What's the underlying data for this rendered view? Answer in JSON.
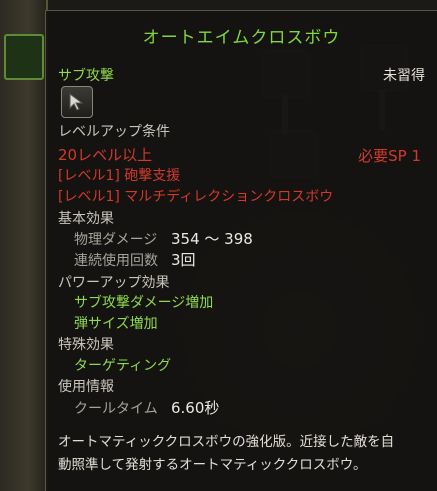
{
  "tooltip": {
    "title": "オートエイムクロスボウ",
    "subtype": "サブ攻撃",
    "learn_status": "未習得",
    "skill_icon": "crossbow-cursor-icon",
    "levelup": {
      "header": "レベルアップ条件",
      "level_req": "20レベル以上",
      "req1": "[レベル1] 砲撃支援",
      "req2": "[レベル1] マルチディレクションクロスボウ",
      "sp": "必要SP 1"
    },
    "basic": {
      "header": "基本効果",
      "damage_label": "物理ダメージ",
      "damage_value": "354 ～ 398",
      "count_label": "連続使用回数",
      "count_value": "3回"
    },
    "powerup": {
      "header": "パワーアップ効果",
      "items": [
        "サブ攻撃ダメージ増加",
        "弾サイズ増加"
      ]
    },
    "special": {
      "header": "特殊効果",
      "items": [
        "ターゲティング"
      ]
    },
    "usage": {
      "header": "使用情報",
      "cooldown_label": "クールタイム",
      "cooldown_value": "6.60秒"
    },
    "description_line1": "オートマティッククロスボウの強化版。近接した敵を自",
    "description_line2": "動照準して発射するオートマティッククロスボウ。"
  },
  "colors": {
    "title_green": "#7fd93a",
    "effect_green": "#8fd94c",
    "requirement_red": "#d2392b",
    "label_gray": "#a6a39a"
  }
}
